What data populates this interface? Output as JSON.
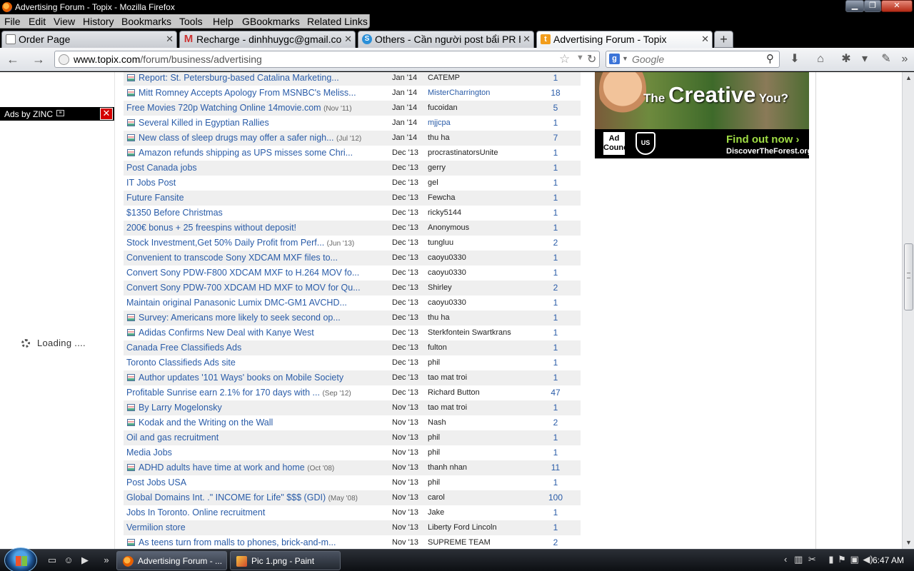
{
  "window": {
    "title": "Advertising Forum - Topix - Mozilla Firefox",
    "min": "▁",
    "max": "❐",
    "close": "✕"
  },
  "menu": [
    "File",
    "Edit",
    "View",
    "History",
    "Bookmarks",
    "Tools",
    "Help",
    "GBookmarks",
    "Related Links"
  ],
  "tabs": [
    {
      "label": "Order Page",
      "icon": "page-icon"
    },
    {
      "label": "Recharge - dinhhuygc@gmail.coÉ",
      "icon": "gmail-icon"
    },
    {
      "label": "Others - Cần người post bẩi PR htÉ",
      "icon": "skype-icon"
    },
    {
      "label": "Advertising Forum - Topix",
      "icon": "topix-icon"
    }
  ],
  "nav": {
    "url_domain": "www.topix.com",
    "url_path": "/forum/business/advertising",
    "search_placeholder": "Google"
  },
  "ads_bar": {
    "label": "Ads by ZINC",
    "close": "✕"
  },
  "loading_text": "Loading ....",
  "rows": [
    {
      "icon": true,
      "topic": "Report: St. Petersburg-based Catalina Marketing...",
      "old": "",
      "date": "Jan '14",
      "author": "CATEMP",
      "author_link": false,
      "count": "1"
    },
    {
      "icon": true,
      "topic": "Mitt Romney Accepts Apology From MSNBC's Meliss...",
      "old": "",
      "date": "Jan '14",
      "author": "MisterCharrington",
      "author_link": true,
      "count": "18"
    },
    {
      "icon": false,
      "topic": "Free Movies 720p Watching Online 14movie.com",
      "old": "(Nov '11)",
      "date": "Jan '14",
      "author": "fucoidan",
      "author_link": false,
      "count": "5"
    },
    {
      "icon": true,
      "topic": "Several Killed in Egyptian Rallies",
      "old": "",
      "date": "Jan '14",
      "author": "mjjcpa",
      "author_link": true,
      "count": "1"
    },
    {
      "icon": true,
      "topic": "New class of sleep drugs may offer a safer nigh...",
      "old": "(Jul '12)",
      "date": "Jan '14",
      "author": "thu ha",
      "author_link": false,
      "count": "7"
    },
    {
      "icon": true,
      "topic": "Amazon refunds shipping as UPS misses some Chri...",
      "old": "",
      "date": "Dec '13",
      "author": "procrastinatorsUnite",
      "author_link": false,
      "count": "1"
    },
    {
      "icon": false,
      "topic": "Post Canada jobs",
      "old": "",
      "date": "Dec '13",
      "author": "gerry",
      "author_link": false,
      "count": "1"
    },
    {
      "icon": false,
      "topic": "IT Jobs Post",
      "old": "",
      "date": "Dec '13",
      "author": "gel",
      "author_link": false,
      "count": "1"
    },
    {
      "icon": false,
      "topic": "Future Fansite",
      "old": "",
      "date": "Dec '13",
      "author": "Fewcha",
      "author_link": false,
      "count": "1"
    },
    {
      "icon": false,
      "topic": "$1350 Before Christmas",
      "old": "",
      "date": "Dec '13",
      "author": "ricky5144",
      "author_link": false,
      "count": "1"
    },
    {
      "icon": false,
      "topic": "200€ bonus + 25 freespins without deposit!",
      "old": "",
      "date": "Dec '13",
      "author": "Anonymous",
      "author_link": false,
      "count": "1"
    },
    {
      "icon": false,
      "topic": "Stock Investment,Get 50% Daily Profit from Perf...",
      "old": "(Jun '13)",
      "date": "Dec '13",
      "author": "tungluu",
      "author_link": false,
      "count": "2"
    },
    {
      "icon": false,
      "topic": "Convenient to transcode Sony XDCAM MXF files to...",
      "old": "",
      "date": "Dec '13",
      "author": "caoyu0330",
      "author_link": false,
      "count": "1"
    },
    {
      "icon": false,
      "topic": "Convert Sony PDW-F800 XDCAM MXF to H.264 MOV fo...",
      "old": "",
      "date": "Dec '13",
      "author": "caoyu0330",
      "author_link": false,
      "count": "1"
    },
    {
      "icon": false,
      "topic": "Convert Sony PDW-700 XDCAM HD MXF to MOV for Qu...",
      "old": "",
      "date": "Dec '13",
      "author": "Shirley",
      "author_link": false,
      "count": "2"
    },
    {
      "icon": false,
      "topic": "Maintain original Panasonic Lumix DMC-GM1 AVCHD...",
      "old": "",
      "date": "Dec '13",
      "author": "caoyu0330",
      "author_link": false,
      "count": "1"
    },
    {
      "icon": true,
      "topic": "Survey: Americans more likely to seek second op...",
      "old": "",
      "date": "Dec '13",
      "author": "thu ha",
      "author_link": false,
      "count": "1"
    },
    {
      "icon": true,
      "topic": "Adidas Confirms New Deal with Kanye West",
      "old": "",
      "date": "Dec '13",
      "author": "Sterkfontein Swartkrans",
      "author_link": false,
      "count": "1"
    },
    {
      "icon": false,
      "topic": "Canada Free Classifieds Ads",
      "old": "",
      "date": "Dec '13",
      "author": "fulton",
      "author_link": false,
      "count": "1"
    },
    {
      "icon": false,
      "topic": "Toronto Classifieds Ads site",
      "old": "",
      "date": "Dec '13",
      "author": "phil",
      "author_link": false,
      "count": "1"
    },
    {
      "icon": true,
      "topic": "Author updates '101 Ways' books on Mobile Society",
      "old": "",
      "date": "Dec '13",
      "author": "tao mat troi",
      "author_link": false,
      "count": "1"
    },
    {
      "icon": false,
      "topic": "Profitable Sunrise earn 2.1% for 170 days with ...",
      "old": "(Sep '12)",
      "date": "Dec '13",
      "author": "Richard Button",
      "author_link": false,
      "count": "47"
    },
    {
      "icon": true,
      "topic": "By Larry Mogelonsky",
      "old": "",
      "date": "Nov '13",
      "author": "tao mat troi",
      "author_link": false,
      "count": "1"
    },
    {
      "icon": true,
      "topic": "Kodak and the Writing on the Wall",
      "old": "",
      "date": "Nov '13",
      "author": "Nash",
      "author_link": false,
      "count": "2"
    },
    {
      "icon": false,
      "topic": "Oil and gas recruitment",
      "old": "",
      "date": "Nov '13",
      "author": "phil",
      "author_link": false,
      "count": "1"
    },
    {
      "icon": false,
      "topic": "Media Jobs",
      "old": "",
      "date": "Nov '13",
      "author": "phil",
      "author_link": false,
      "count": "1"
    },
    {
      "icon": true,
      "topic": "ADHD adults have time at work and home",
      "old": "(Oct '08)",
      "date": "Nov '13",
      "author": "thanh nhan",
      "author_link": false,
      "count": "11"
    },
    {
      "icon": false,
      "topic": "Post Jobs USA",
      "old": "",
      "date": "Nov '13",
      "author": "phil",
      "author_link": false,
      "count": "1"
    },
    {
      "icon": false,
      "topic": "Global Domains Int. .\" INCOME for Life\" $$$ (GDI)",
      "old": "(May '08)",
      "date": "Nov '13",
      "author": "carol",
      "author_link": false,
      "count": "100"
    },
    {
      "icon": false,
      "topic": "Jobs In Toronto. Online recruitment",
      "old": "",
      "date": "Nov '13",
      "author": "Jake",
      "author_link": false,
      "count": "1"
    },
    {
      "icon": false,
      "topic": "Vermilion store",
      "old": "",
      "date": "Nov '13",
      "author": "Liberty Ford Lincoln",
      "author_link": false,
      "count": "1"
    },
    {
      "icon": true,
      "topic": "As teens turn from malls to phones, brick-and-m...",
      "old": "",
      "date": "Nov '13",
      "author": "SUPREME TEAM",
      "author_link": false,
      "count": "2"
    }
  ],
  "ad": {
    "headline_small": "The",
    "headline_big": "Creative",
    "headline_end": "You?",
    "adcouncil": "Ad Council",
    "shield": "US",
    "cta": "Find out now ›",
    "site": "DiscoverTheForest.org"
  },
  "taskbar": {
    "items": [
      {
        "label": "Advertising Forum - ...",
        "icon": "firefox-icon"
      },
      {
        "label": "Pic 1.png - Paint",
        "icon": "paint-icon"
      }
    ],
    "clock": "6:47 AM"
  }
}
